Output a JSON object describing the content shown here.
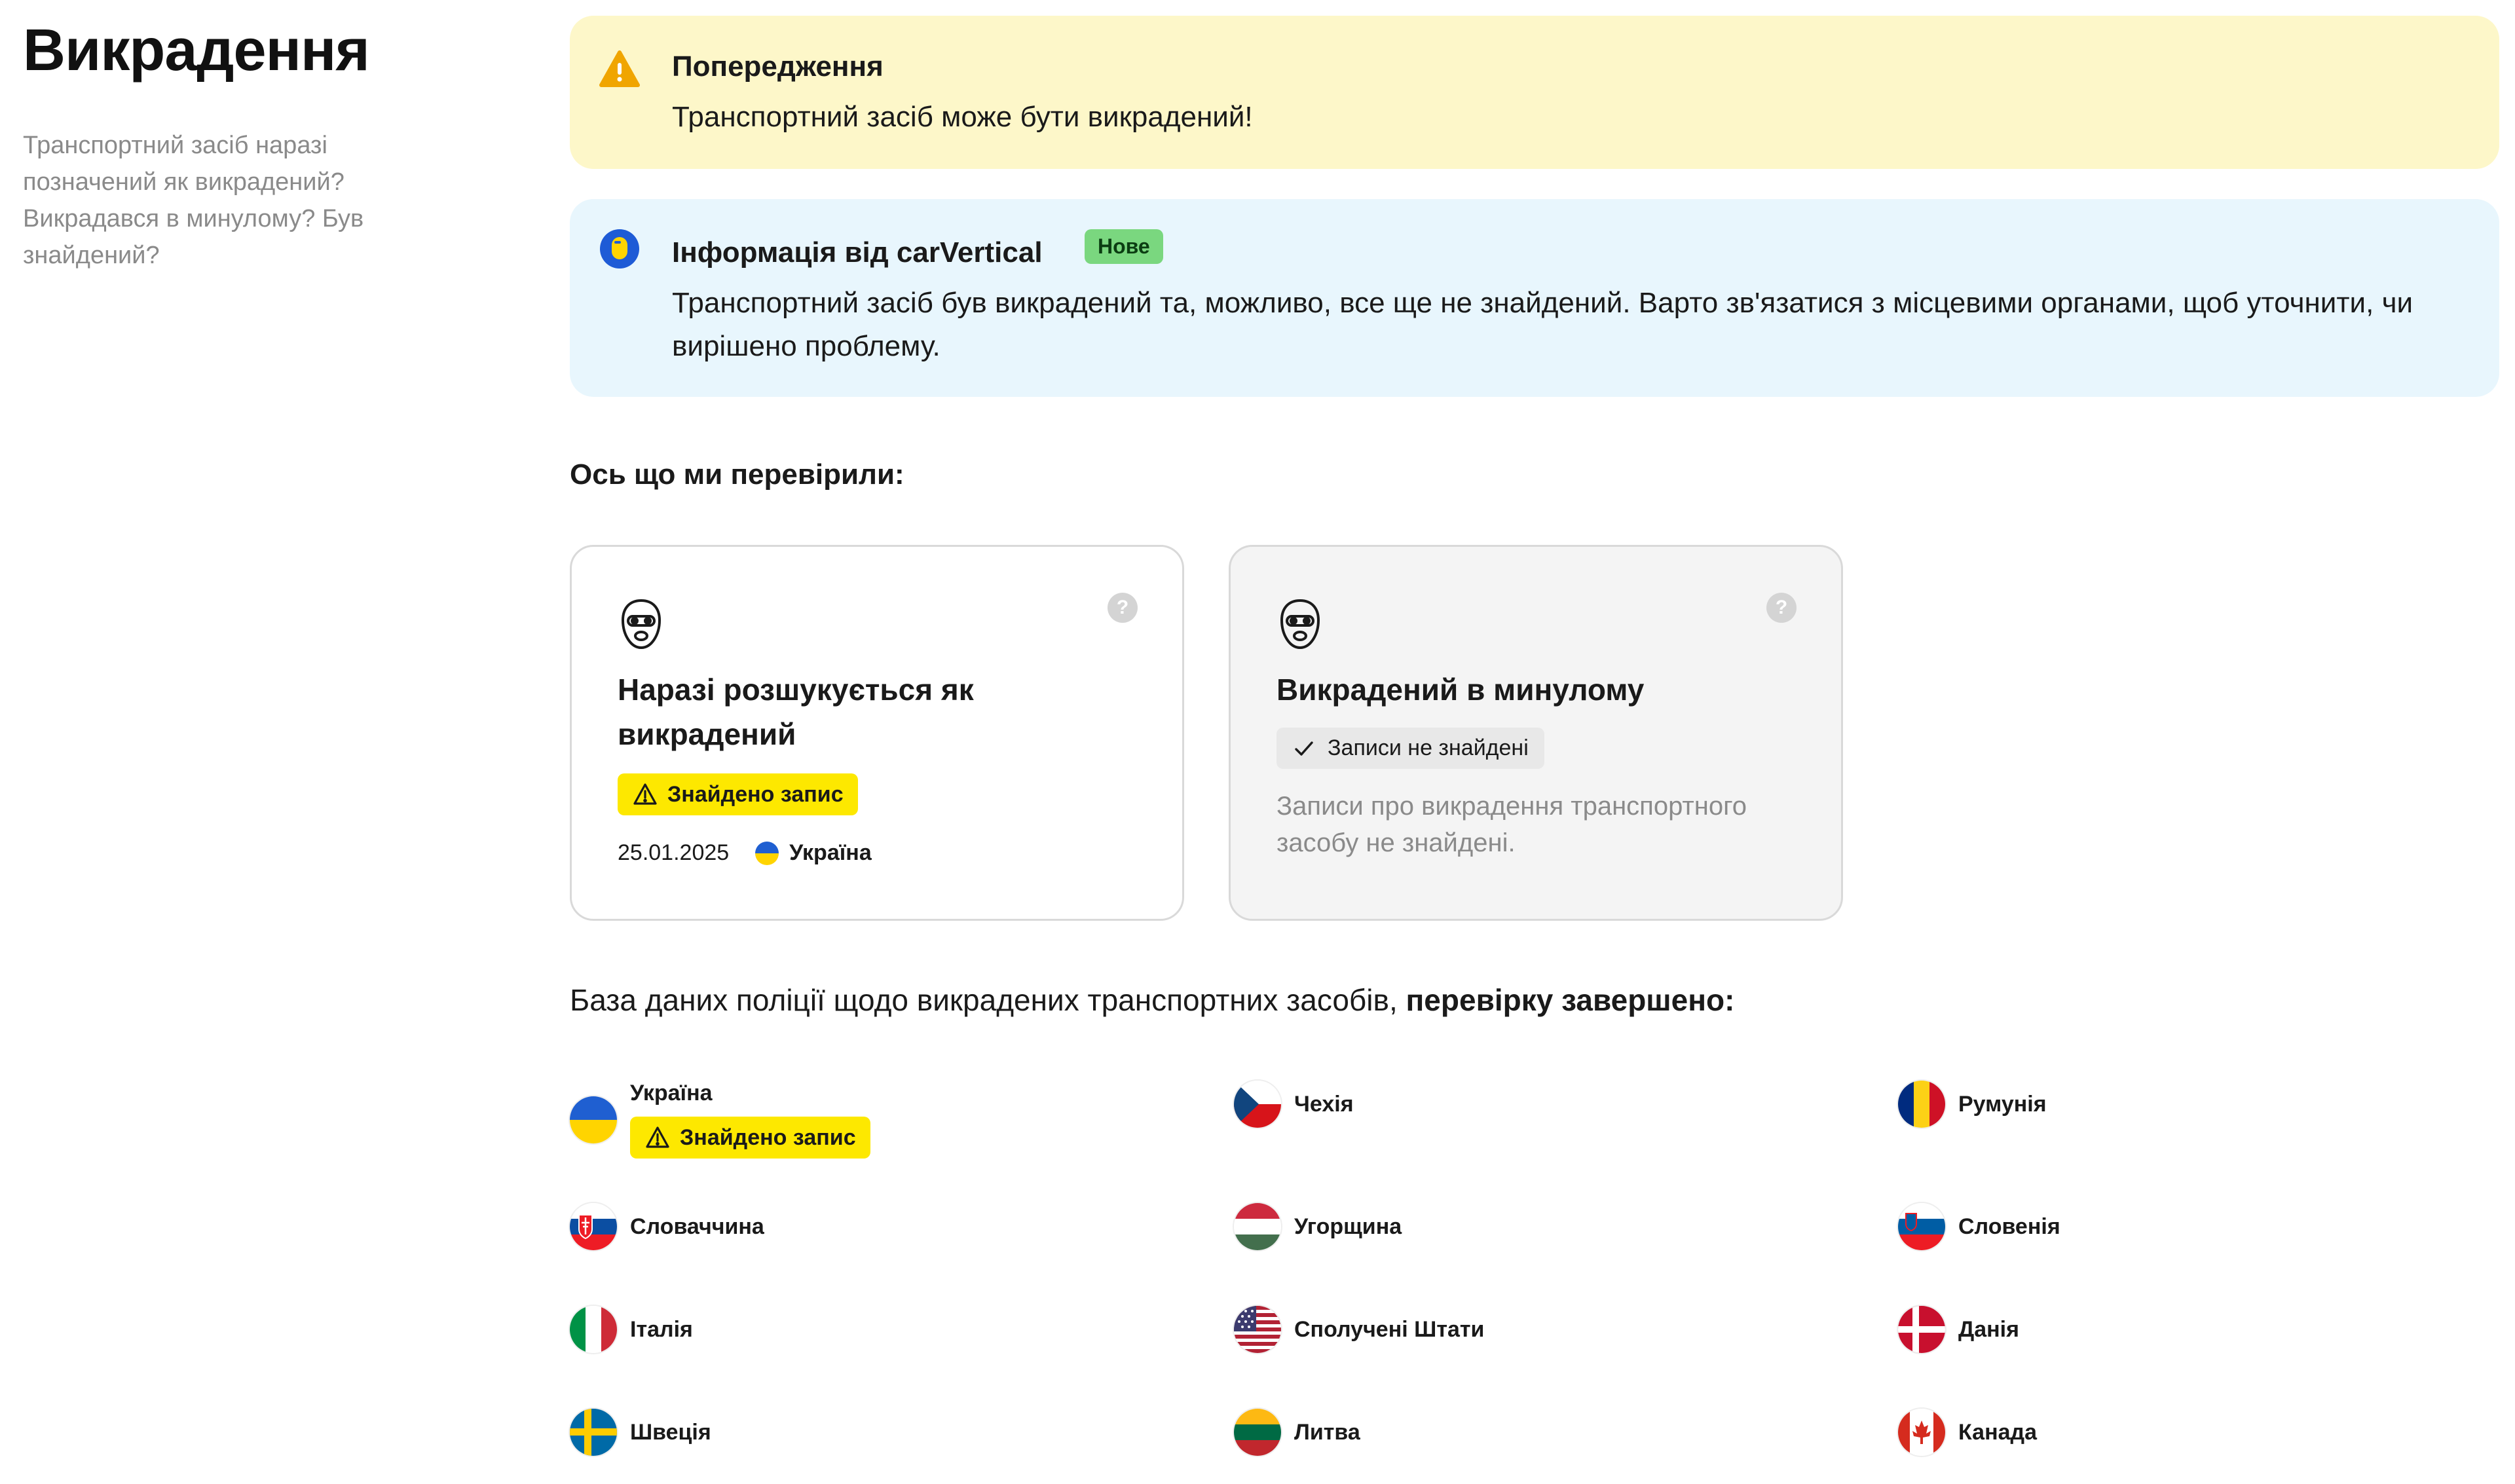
{
  "section": {
    "title": "Викрадення",
    "description": "Транспортний засіб наразі позначений як викрадений? Викрадався в минулому? Був знайдений?"
  },
  "warning_alert": {
    "title": "Попередження",
    "text": "Транспортний засіб може бути викрадений!",
    "icon": "warning-icon",
    "color": "#fdf7c9"
  },
  "info_alert": {
    "title": "Інформація від carVertical",
    "badge": "Нове",
    "text": "Транспортний засіб був викрадений та, можливо, все ще не знайдений. Варто зв'язатися з місцевими органами, щоб уточнити, чи вирішено проблему.",
    "icon": "carvertical-logo-icon",
    "color": "#e8f6fd"
  },
  "checked_heading": "Ось що ми перевірили:",
  "cards": [
    {
      "title": "Наразі розшукується як викрадений",
      "status": "Знайдено запис",
      "date": "25.01.2025",
      "country": "Україна",
      "icon": "thief-mask-icon",
      "help": "?"
    },
    {
      "title": "Викрадений в минулому",
      "status": "Записи не знайдені",
      "note": "Записи про викрадення транспортного засобу не знайдені.",
      "icon": "thief-mask-icon",
      "help": "?"
    }
  ],
  "database_line": {
    "text": "База даних поліції щодо викрадених транспортних засобів,",
    "status": "перевірку завершено:"
  },
  "countries": [
    {
      "name": "Україна",
      "badge": "Знайдено запис"
    },
    {
      "name": "Чехія"
    },
    {
      "name": "Румунія"
    },
    {
      "name": "Словаччина"
    },
    {
      "name": "Угорщина"
    },
    {
      "name": "Словенія"
    },
    {
      "name": "Італія"
    },
    {
      "name": "Сполучені Штати"
    },
    {
      "name": "Данія"
    },
    {
      "name": "Швеція"
    },
    {
      "name": "Литва"
    },
    {
      "name": "Канада"
    }
  ],
  "colors": {
    "found_badge": "#fde800",
    "new_badge": "#7ad77f",
    "warning_icon": "#f0a500"
  }
}
